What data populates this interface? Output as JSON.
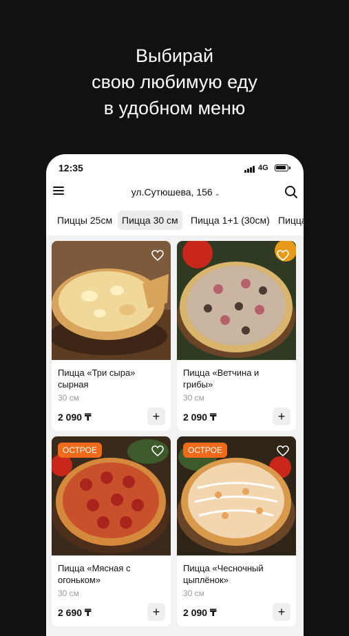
{
  "promo": {
    "line1": "Выбирай",
    "line2": "свою любимую еду",
    "line3": "в удобном меню"
  },
  "status_bar": {
    "time": "12:35",
    "network": "4G"
  },
  "header": {
    "address": "ул.Сутюшева, 156",
    "menu_icon": "hamburger-icon",
    "search_icon": "search-icon"
  },
  "tabs": [
    {
      "label": "Пиццы 25см",
      "active": false
    },
    {
      "label": "Пицца 30 см",
      "active": true
    },
    {
      "label": "Пицца 1+1 (30см)",
      "active": false
    },
    {
      "label": "Пицца",
      "active": false
    }
  ],
  "products": [
    {
      "name": "Пицца «Три сыра» сырная",
      "size": "30 см",
      "price": "2 090 ₸",
      "badge": "",
      "add_label": "+"
    },
    {
      "name": "Пицца «Ветчина и грибы»",
      "size": "30 см",
      "price": "2 090 ₸",
      "badge": "",
      "add_label": "+"
    },
    {
      "name": "Пицца «Мясная с огоньком»",
      "size": "30 см",
      "price": "2 690 ₸",
      "badge": "ОСТРОЕ",
      "add_label": "+"
    },
    {
      "name": "Пицца «Чесночный цыплёнок»",
      "size": "30 см",
      "price": "2 090 ₸",
      "badge": "ОСТРОЕ",
      "add_label": "+"
    }
  ],
  "colors": {
    "background": "#111111",
    "badge": "#f06a1a",
    "active_tab": "#ececec"
  }
}
